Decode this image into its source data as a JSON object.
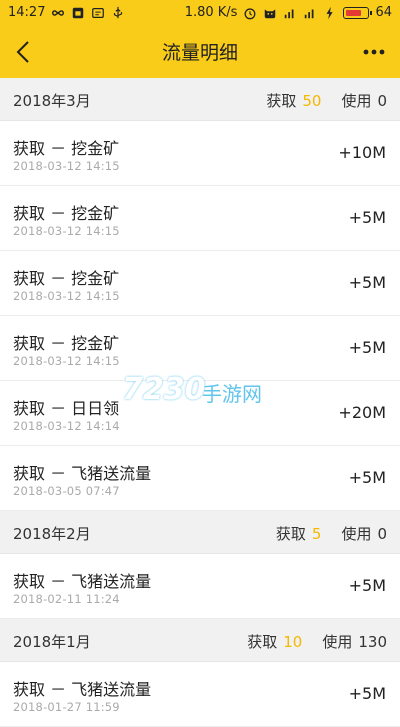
{
  "status_bar": {
    "time": "14:27",
    "net_speed": "1.80 K/s",
    "battery_level": "64"
  },
  "header": {
    "title": "流量明细"
  },
  "sections": [
    {
      "month": "2018年3月",
      "earn_label": "获取",
      "earn_value": "50",
      "used_label": "使用",
      "used_value": "0",
      "rows": [
        {
          "title": "获取 － 挖金矿",
          "time": "2018-03-12 14:15",
          "amount": "+10M"
        },
        {
          "title": "获取 － 挖金矿",
          "time": "2018-03-12 14:15",
          "amount": "+5M"
        },
        {
          "title": "获取 － 挖金矿",
          "time": "2018-03-12 14:15",
          "amount": "+5M"
        },
        {
          "title": "获取 － 挖金矿",
          "time": "2018-03-12 14:15",
          "amount": "+5M"
        },
        {
          "title": "获取 － 日日领",
          "time": "2018-03-12 14:14",
          "amount": "+20M"
        },
        {
          "title": "获取 － 飞猪送流量",
          "time": "2018-03-05 07:47",
          "amount": "+5M"
        }
      ]
    },
    {
      "month": "2018年2月",
      "earn_label": "获取",
      "earn_value": "5",
      "used_label": "使用",
      "used_value": "0",
      "rows": [
        {
          "title": "获取 － 飞猪送流量",
          "time": "2018-02-11 11:24",
          "amount": "+5M"
        }
      ]
    },
    {
      "month": "2018年1月",
      "earn_label": "获取",
      "earn_value": "10",
      "used_label": "使用",
      "used_value": "130",
      "rows": [
        {
          "title": "获取 － 飞猪送流量",
          "time": "2018-01-27 11:59",
          "amount": "+5M"
        }
      ]
    }
  ],
  "watermark": {
    "number": "7230",
    "text": "手游网"
  },
  "colors": {
    "header_bg": "#f9cc1a",
    "earn_accent": "#f5b800",
    "section_bg": "#f1f1f1"
  }
}
